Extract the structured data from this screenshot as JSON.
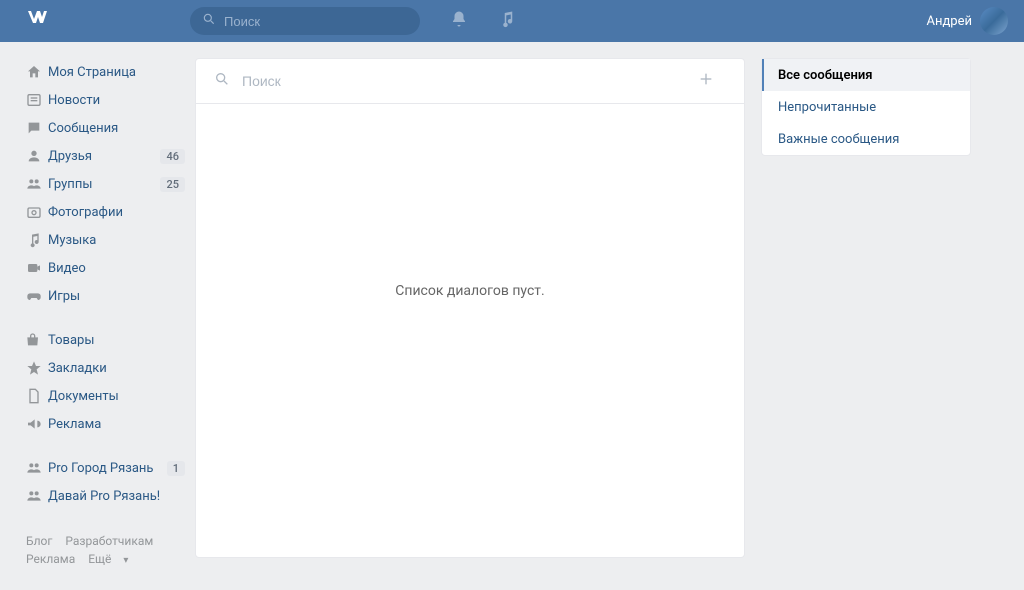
{
  "header": {
    "logo": "W",
    "search_placeholder": "Поиск",
    "user_name": "Андрей"
  },
  "sidebar": {
    "items": [
      {
        "label": "Моя Страница",
        "icon": "home"
      },
      {
        "label": "Новости",
        "icon": "news"
      },
      {
        "label": "Сообщения",
        "icon": "messages"
      },
      {
        "label": "Друзья",
        "icon": "friends",
        "badge": "46"
      },
      {
        "label": "Группы",
        "icon": "groups",
        "badge": "25"
      },
      {
        "label": "Фотографии",
        "icon": "photos"
      },
      {
        "label": "Музыка",
        "icon": "music"
      },
      {
        "label": "Видео",
        "icon": "video"
      },
      {
        "label": "Игры",
        "icon": "games"
      }
    ],
    "items2": [
      {
        "label": "Товары",
        "icon": "market"
      },
      {
        "label": "Закладки",
        "icon": "bookmarks"
      },
      {
        "label": "Документы",
        "icon": "docs"
      },
      {
        "label": "Реклама",
        "icon": "ads"
      }
    ],
    "items3": [
      {
        "label": "Pro Город Рязань",
        "icon": "groups",
        "badge": "1"
      },
      {
        "label": "Давай Pro Рязань!",
        "icon": "groups"
      }
    ]
  },
  "footer": {
    "links": [
      "Блог",
      "Разработчикам",
      "Реклама",
      "Ещё"
    ]
  },
  "main": {
    "search_placeholder": "Поиск",
    "empty_text": "Список диалогов пуст."
  },
  "filters": {
    "items": [
      "Все сообщения",
      "Непрочитанные",
      "Важные сообщения"
    ],
    "active": 0
  }
}
